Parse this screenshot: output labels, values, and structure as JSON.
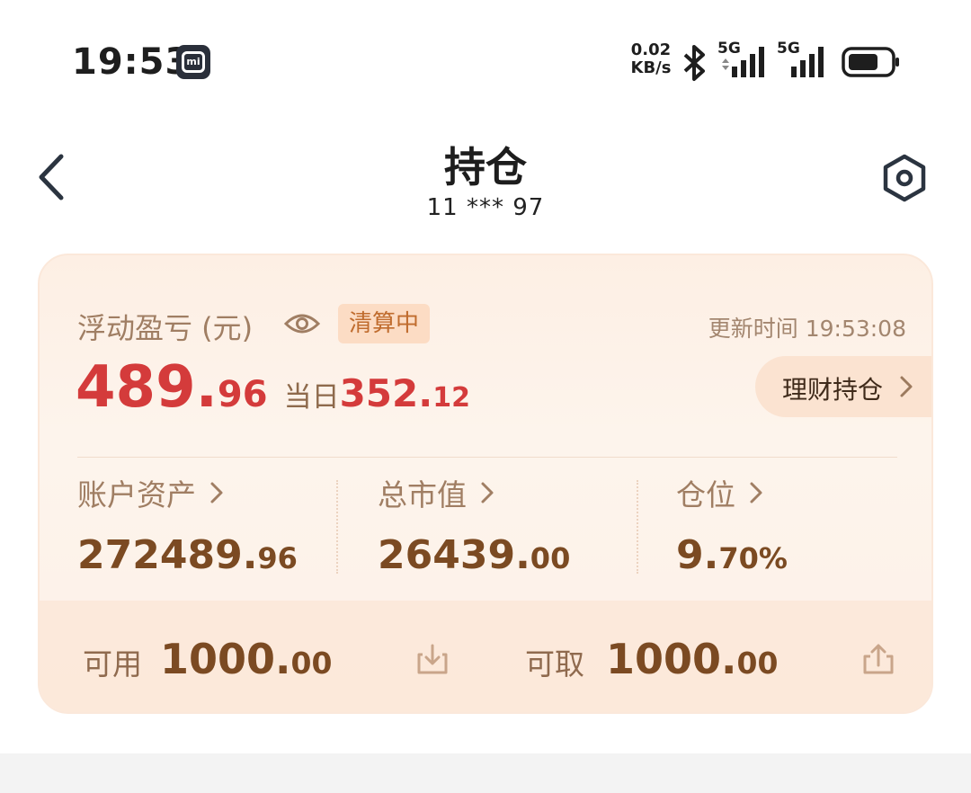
{
  "status_bar": {
    "time": "19:53",
    "net_speed_value": "0.02",
    "net_speed_unit": "KB/s",
    "sim1_label": "5G",
    "sim2_label": "5G"
  },
  "header": {
    "title": "持仓",
    "account": "11 *** 97"
  },
  "summary": {
    "pl_label": "浮动盈亏 (元)",
    "status_badge": "清算中",
    "update_time": "更新时间 19:53:08",
    "pl_int": "489.",
    "pl_dec": "96",
    "day_label": "当日",
    "day_int": "352.",
    "day_dec": "12",
    "wealth_button": "理财持仓"
  },
  "metrics": [
    {
      "label": "账户资产",
      "int": "272489.",
      "dec": "96"
    },
    {
      "label": "总市值",
      "int": "26439.",
      "dec": "00"
    },
    {
      "label": "仓位",
      "int": "9.",
      "dec": "70%"
    }
  ],
  "funds": {
    "available_label": "可用",
    "available_int": "1000.",
    "available_dec": "00",
    "withdrawable_label": "可取",
    "withdrawable_int": "1000.",
    "withdrawable_dec": "00"
  },
  "colors": {
    "profit_red": "#d43b3b",
    "value_brown": "#7b4a22",
    "label_tan": "#a07e63",
    "badge_orange": "#c06c2e"
  }
}
